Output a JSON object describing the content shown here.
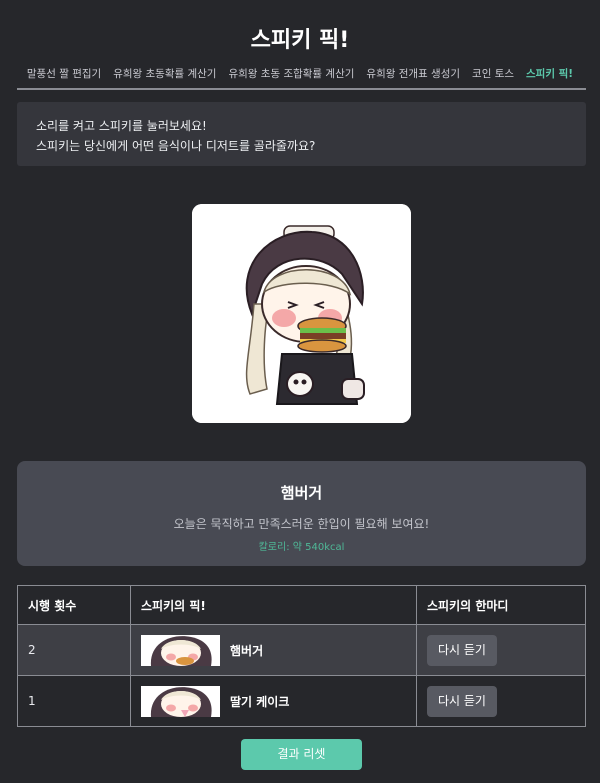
{
  "page": {
    "title": "스피키 픽!"
  },
  "nav": {
    "items": [
      {
        "label": "말풍선 짤 편집기"
      },
      {
        "label": "유희왕 초동확률 계산기"
      },
      {
        "label": "유희왕 초동 조합확률 계산기"
      },
      {
        "label": "유희왕 전개표 생성기"
      },
      {
        "label": "코인 토스"
      },
      {
        "label": "스피키 픽!"
      }
    ],
    "active_index": 5
  },
  "intro": {
    "line1": "소리를 켜고 스피키를 눌러보세요!",
    "line2": "스피키는 당신에게 어떤 음식이나 디저트를 골라줄까요?"
  },
  "result": {
    "food_name": "햄버거",
    "description": "오늘은 묵직하고 만족스러운 한입이 필요해 보여요!",
    "calories": "칼로리: 약 540kcal"
  },
  "history": {
    "headers": {
      "count": "시행 횟수",
      "pick": "스피키의 픽!",
      "comment": "스피키의 한마디"
    },
    "rows": [
      {
        "count": "2",
        "pick": "햄버거",
        "button": "다시 듣기"
      },
      {
        "count": "1",
        "pick": "딸기 케이크",
        "button": "다시 듣기"
      }
    ]
  },
  "reset_label": "결과 리셋",
  "colors": {
    "accent": "#5cc9ac",
    "background": "#26272b",
    "panel": "#35363c",
    "card": "#484a53"
  }
}
